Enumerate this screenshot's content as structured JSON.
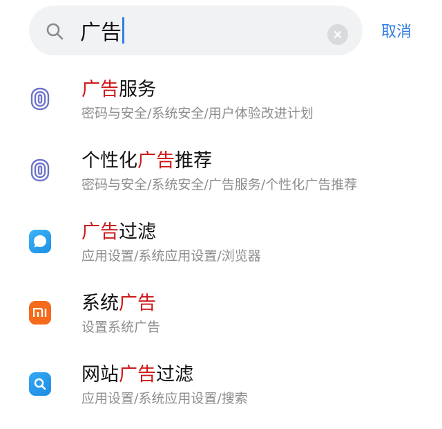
{
  "search": {
    "query": "广告",
    "cancel_label": "取消"
  },
  "results": [
    {
      "icon": "fingerprint-icon",
      "title_parts": [
        {
          "text": "广告",
          "highlight": true
        },
        {
          "text": "服务",
          "highlight": false
        }
      ],
      "path": "密码与安全/系统安全/用户体验改进计划"
    },
    {
      "icon": "fingerprint-icon",
      "title_parts": [
        {
          "text": "个性化",
          "highlight": false
        },
        {
          "text": "广告",
          "highlight": true
        },
        {
          "text": "推荐",
          "highlight": false
        }
      ],
      "path": "密码与安全/系统安全/广告服务/个性化广告推荐"
    },
    {
      "icon": "browser-app-icon",
      "title_parts": [
        {
          "text": "广告",
          "highlight": true
        },
        {
          "text": "过滤",
          "highlight": false
        }
      ],
      "path": "应用设置/系统应用设置/浏览器"
    },
    {
      "icon": "mi-logo-icon",
      "title_parts": [
        {
          "text": "系统",
          "highlight": false
        },
        {
          "text": "广告",
          "highlight": true
        }
      ],
      "path": "设置系统广告"
    },
    {
      "icon": "search-app-icon",
      "title_parts": [
        {
          "text": "网站",
          "highlight": false
        },
        {
          "text": "广告",
          "highlight": true
        },
        {
          "text": "过滤",
          "highlight": false
        }
      ],
      "path": "应用设置/系统应用设置/搜索"
    }
  ],
  "colors": {
    "accent": "#2f7de1",
    "highlight": "#cc1a1a",
    "path_gray": "#8d8d8d",
    "fingerprint_purple": "#6c73c9"
  }
}
